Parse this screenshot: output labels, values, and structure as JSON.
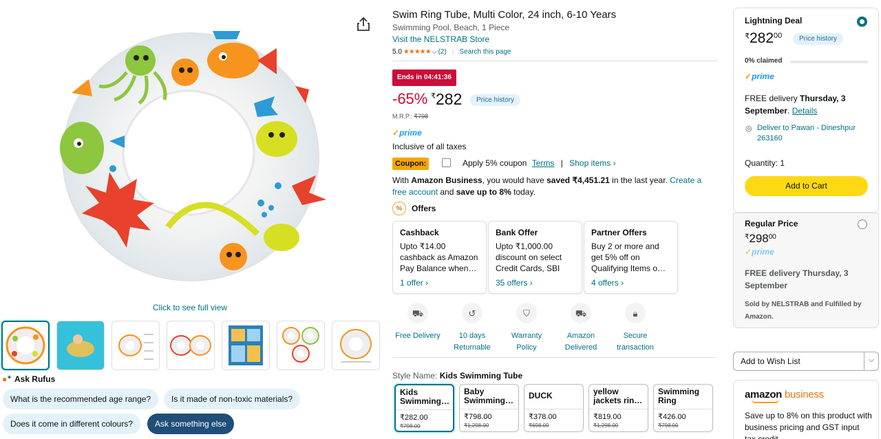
{
  "gallery": {
    "click_full_view": "Click to see full view",
    "thumbnail_count": 7
  },
  "rufus": {
    "title": "Ask Rufus",
    "chips": [
      "What is the recommended age range?",
      "Is it made of non-toxic materials?",
      "Does it come in different colours?",
      "Ask something else"
    ]
  },
  "product": {
    "title": "Swim Ring Tube, Multi Color, 24 inch, 6-10 Years",
    "subtitle": "Swimming Pool, Beach, 1 Piece",
    "store_link": "Visit the NELSTRAB Store",
    "rating": "5.0",
    "stars": "★★★★★",
    "rating_count": "(2)",
    "search_page": "Search this page",
    "deal_badge": "Ends in 04:41:36",
    "discount": "-65%",
    "currency": "₹",
    "price": "282",
    "price_history": "Price history",
    "mrp_label": "M.R.P.:",
    "mrp_value": "₹798",
    "prime": "prime",
    "inclusive": "Inclusive of all taxes",
    "coupon_label": "Coupon:",
    "coupon_text": "Apply 5% coupon",
    "terms": "Terms",
    "shop_items": "Shop items ›",
    "business": {
      "t1": "With ",
      "t2": "Amazon Business",
      "t3": ", you would have ",
      "t4": "saved ₹4,451.21",
      "t5": " in the last year. ",
      "link": "Create a free account",
      "t6": " and ",
      "t7": "save up to 8%",
      "t8": " today."
    },
    "offers_title": "Offers",
    "offers": [
      {
        "title": "Cashback",
        "body": "Upto ₹14.00 cashback as Amazon Pay Balance when…",
        "link": "1 offer ›"
      },
      {
        "title": "Bank Offer",
        "body": "Upto ₹1,000.00 discount on select Credit Cards, SBI D…",
        "link": "35 offers ›"
      },
      {
        "title": "Partner Offers",
        "body": "Buy 2 or more and get 5% off on Qualifying Items o…",
        "link": "4 offers ›"
      }
    ],
    "features": [
      {
        "l1": "Free Delivery",
        "l2": ""
      },
      {
        "l1": "10 days",
        "l2": "Returnable"
      },
      {
        "l1": "Warranty",
        "l2": "Policy"
      },
      {
        "l1": "Amazon",
        "l2": "Delivered"
      },
      {
        "l1": "Secure",
        "l2": "transaction"
      }
    ],
    "style_label": "Style Name: ",
    "style_selected": "Kids Swimming Tube",
    "styles": [
      {
        "name": "Kids Swimming…",
        "price": "₹282.00",
        "old": "₹798.00"
      },
      {
        "name": "Baby Swimming…",
        "price": "₹798.00",
        "old": "₹1,298.00"
      },
      {
        "name": "DUCK",
        "price": "₹378.00",
        "old": "₹698.00"
      },
      {
        "name": "yellow jackets rin…",
        "price": "₹819.00",
        "old": "₹1,298.00"
      },
      {
        "name": "Swimming Ring",
        "price": "₹426.00",
        "old": "₹798.00"
      }
    ]
  },
  "buybox": {
    "deal_title": "Lightning Deal",
    "deal_price_whole": "282",
    "deal_price_fraction": "00",
    "price_history": "Price history",
    "claimed": "0% claimed",
    "claimed_fraction": 0.0,
    "prime": "prime",
    "delivery_1": "FREE delivery ",
    "delivery_2": "Thursday, 3 September",
    "delivery_3": ". ",
    "details": "Details",
    "deliver_to": "Deliver to Pawan - Dineshpur 263160",
    "quantity": "Quantity: 1",
    "add_to_cart": "Add to Cart",
    "regular_title": "Regular Price",
    "regular_whole": "298",
    "regular_fraction": "00",
    "regular_delivery": "FREE delivery Thursday, 3 September",
    "sold_by": "Sold by NELSTRAB and Fulfilled by Amazon.",
    "wishlist": "Add to Wish List",
    "business_logo_1": "amazon",
    "business_logo_2": "business",
    "business_text": "Save up to 8% on this product with business pricing and GST input tax credit."
  },
  "colors": {
    "accent_teal": "#007185",
    "deal_red": "#cc0c39",
    "cart_yellow": "#ffd814",
    "prime_blue": "#1a98ff",
    "coupon_orange": "#f7a600"
  }
}
